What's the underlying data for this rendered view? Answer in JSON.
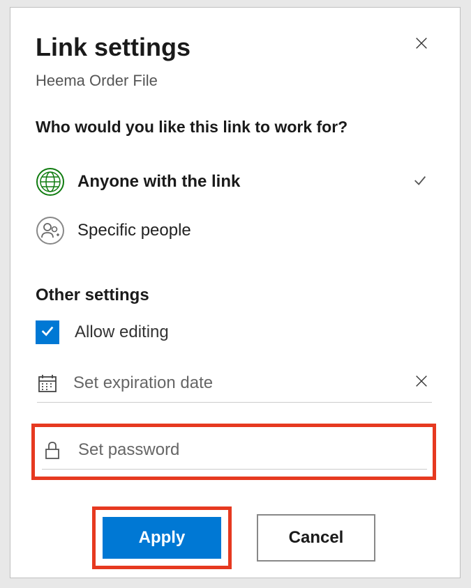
{
  "dialog": {
    "title": "Link settings",
    "subtitle": "Heema Order File",
    "question": "Who would you like this link to work for?"
  },
  "options": {
    "anyone": "Anyone with the link",
    "specific": "Specific people"
  },
  "other_settings": {
    "heading": "Other settings",
    "allow_editing": "Allow editing",
    "expiration_placeholder": "Set expiration date",
    "password_placeholder": "Set password"
  },
  "buttons": {
    "apply": "Apply",
    "cancel": "Cancel"
  }
}
